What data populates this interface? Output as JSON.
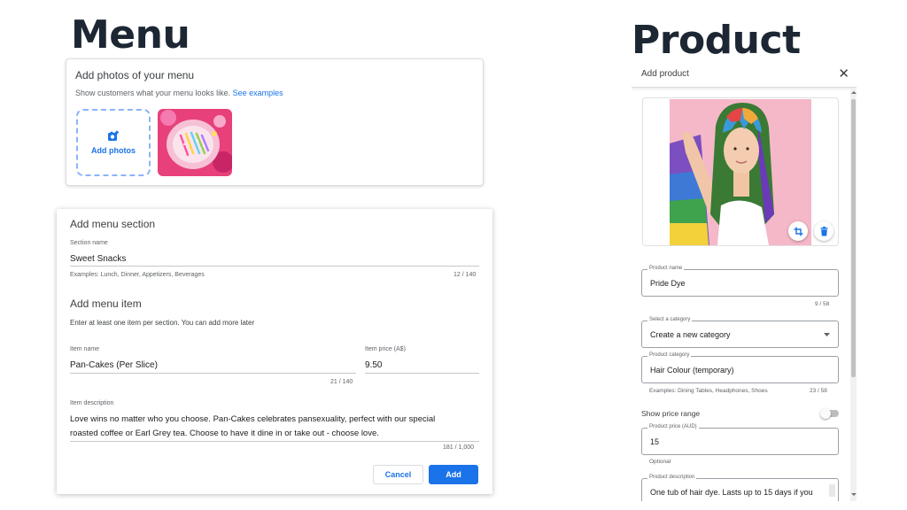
{
  "headings": {
    "menu": "Menu",
    "product": "Product"
  },
  "photos_card": {
    "title": "Add photos of your menu",
    "subtitle": "Show customers what your menu looks like.",
    "see_examples": "See examples",
    "add_photos_label": "Add photos"
  },
  "menu_section": {
    "title": "Add menu section",
    "section_name_label": "Section name",
    "section_name_value": "Sweet Snacks",
    "section_name_hint": "Examples: Lunch, Dinner, Appetizers, Beverages",
    "section_name_count": "12 / 140",
    "item_title": "Add menu item",
    "item_subtitle": "Enter at least one item per section. You can add more later",
    "item_name_label": "Item name",
    "item_name_value": "Pan-Cakes (Per Slice)",
    "item_name_count": "21 / 140",
    "item_price_label": "Item price (A$)",
    "item_price_value": "9.50",
    "item_description_label": "Item description",
    "item_description_line1": "Love wins no matter who you choose. Pan-Cakes celebrates pansexuality, perfect with our special",
    "item_description_line2": "roasted coffee or Earl Grey tea. Choose to have it dine in or take out - choose love.",
    "item_description_count": "181 / 1,000",
    "cancel_label": "Cancel",
    "add_label": "Add"
  },
  "product_panel": {
    "title": "Add product",
    "close_glyph": "✕",
    "product_name_label": "Product name",
    "product_name_value": "Pride Dye",
    "product_name_count": "9 / 58",
    "category_select_label": "Select a category",
    "category_select_value": "Create a new category",
    "product_category_label": "Product category",
    "product_category_value": "Hair Colour (temporary)",
    "product_category_hint": "Examples: Dining Tables, Headphones, Shoes",
    "product_category_count": "23 / 58",
    "show_price_range_label": "Show price range",
    "product_price_label": "Product price (AUD)",
    "product_price_value": "15",
    "optional_label": "Optional",
    "product_description_label": "Product description",
    "product_description_value": "One tub of hair dye. Lasts up to 15 days if you"
  },
  "colors": {
    "accent": "#1a73e8",
    "heading": "#1c2733"
  }
}
